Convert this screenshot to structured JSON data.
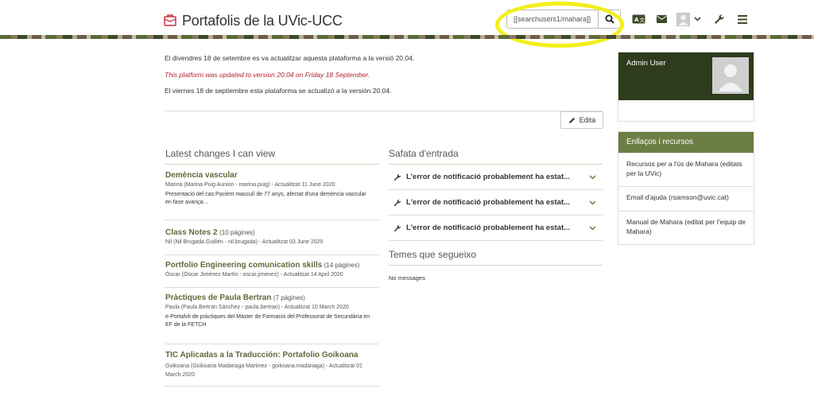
{
  "header": {
    "site_title": "Portafolis de la UVic-UCC",
    "search_value": "[[searchusers1/mahara]]",
    "icons": [
      "logo-icon",
      "translate-icon",
      "mail-icon",
      "user-avatar-icon",
      "chevron-down-icon",
      "wrench-icon",
      "menu-icon",
      "search-icon"
    ]
  },
  "notices": [
    "El divendres 18 de setembre es va actualitzar aquesta plataforma a la versió 20.04.",
    "This platform was updated to version 20.04 on Friday 18 September.",
    "El viernes 18 de septiembre esta plataforma se actualizó a la versión 20.04."
  ],
  "edit_label": "Edita",
  "latest_changes": {
    "heading": "Latest changes I can view",
    "items": [
      {
        "title": "Demència vascular",
        "pages": "",
        "meta": "Marina (Marina Puig Aunion - marina.puig) - Actualitzat 11 June 2020",
        "desc": "Presentació del cas Pacient masculí de 77 anys, afectat d'una demència vascular en fase avança..."
      },
      {
        "title": "Class Notes 2",
        "pages": "(10 pàgines)",
        "meta": "Nil (Nil Brugada Guillén - nil.brugada) - Actualitzat 03 June 2020",
        "desc": ""
      },
      {
        "title": "Portfolio Engineering comunication skills",
        "pages": "(14 pàgines)",
        "meta": "Òscar (Òscar Jiménez Martín - oscar.jimenez) - Actualitzat 14 April 2020",
        "desc": ""
      },
      {
        "title": "Pràctiques de Paula Bertran",
        "pages": "(7 pàgines)",
        "meta": "Paula (Paula Bertran Sánchez - paula.bertran) - Actualitzat 10 March 2020",
        "desc": "e-Portafoli de pràctiques del Màster de Formació del Professorat de Secundària en EF de la FETCH"
      },
      {
        "title": "TIC Aplicadas a la Traducción: Portafolio Goikoana",
        "pages": "",
        "meta": "Goikoana (Goikoana Madariaga Martinez - goikoana.madariaga) - Actualitzat 01 March 2020",
        "desc": ""
      }
    ]
  },
  "inbox": {
    "heading": "Safata d'entrada",
    "items": [
      "L'error de notificació probablement ha estat...",
      "L'error de notificació probablement ha estat...",
      "L'error de notificació probablement ha estat..."
    ]
  },
  "topics": {
    "heading": "Temes que segueixo",
    "empty": "No messages"
  },
  "sidebar": {
    "user_name": "Admin User",
    "links_heading": "Enllaços i recursos",
    "links": [
      "Recursos per a l'ús de Mahara (editats per la UVic)",
      "Email d'ajuda (rsamson@uvic.cat)",
      "Manual de Mahara (editat per l'equip de Mahara)"
    ]
  },
  "colors": {
    "accent": "#6c7e43",
    "dark_green": "#2e3b1d",
    "notice_red": "#b0212e",
    "highlight": "#f2ef18"
  }
}
